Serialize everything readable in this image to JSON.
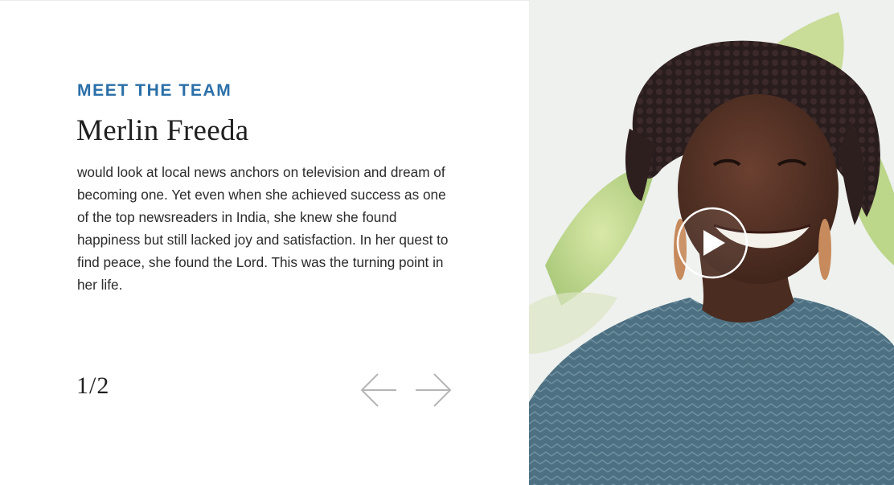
{
  "section": {
    "eyebrow": "MEET THE TEAM",
    "name": "Merlin Freeda",
    "bio": "would look at local news anchors on television and dream of becoming one. Yet even when she achieved success as one of the top newsreaders in India, she knew she found happiness but still lacked joy and satisfaction. In her quest to find peace, she found the Lord. This was the turning point in her life."
  },
  "pagination": {
    "current": "1",
    "separator": "/",
    "total": "2"
  },
  "icons": {
    "prev": "arrow-left-icon",
    "next": "arrow-right-icon",
    "play": "play-icon"
  },
  "colors": {
    "accent": "#2a6fa8",
    "text": "#2b2b2b",
    "arrow": "#b5b5b5"
  }
}
